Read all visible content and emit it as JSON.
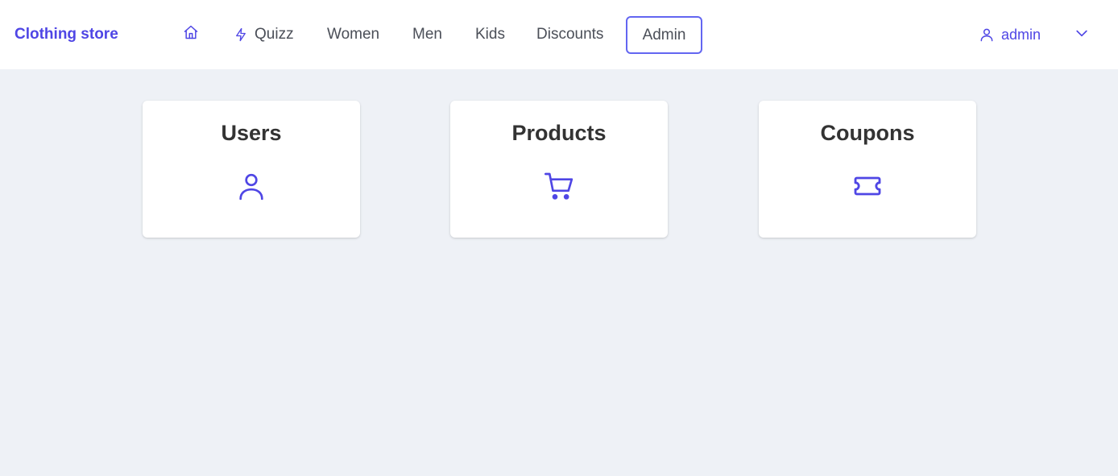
{
  "nav": {
    "brand": "Clothing store",
    "home_icon": "home-icon",
    "links": {
      "quizz": "Quizz",
      "women": "Women",
      "men": "Men",
      "kids": "Kids",
      "discounts": "Discounts",
      "admin": "Admin"
    },
    "quizz_icon": "bolt-icon",
    "active_link": "Admin",
    "user": {
      "name": "admin",
      "icon": "user-icon"
    },
    "dropdown_icon": "chevron-down-icon"
  },
  "cards": {
    "users": {
      "title": "Users",
      "icon": "user-icon"
    },
    "products": {
      "title": "Products",
      "icon": "shopping-cart-icon"
    },
    "coupons": {
      "title": "Coupons",
      "icon": "ticket-icon"
    }
  },
  "colors": {
    "accent": "#4f46e5",
    "active_border": "#6366f1",
    "background": "#eef1f6",
    "text": "#333333"
  }
}
